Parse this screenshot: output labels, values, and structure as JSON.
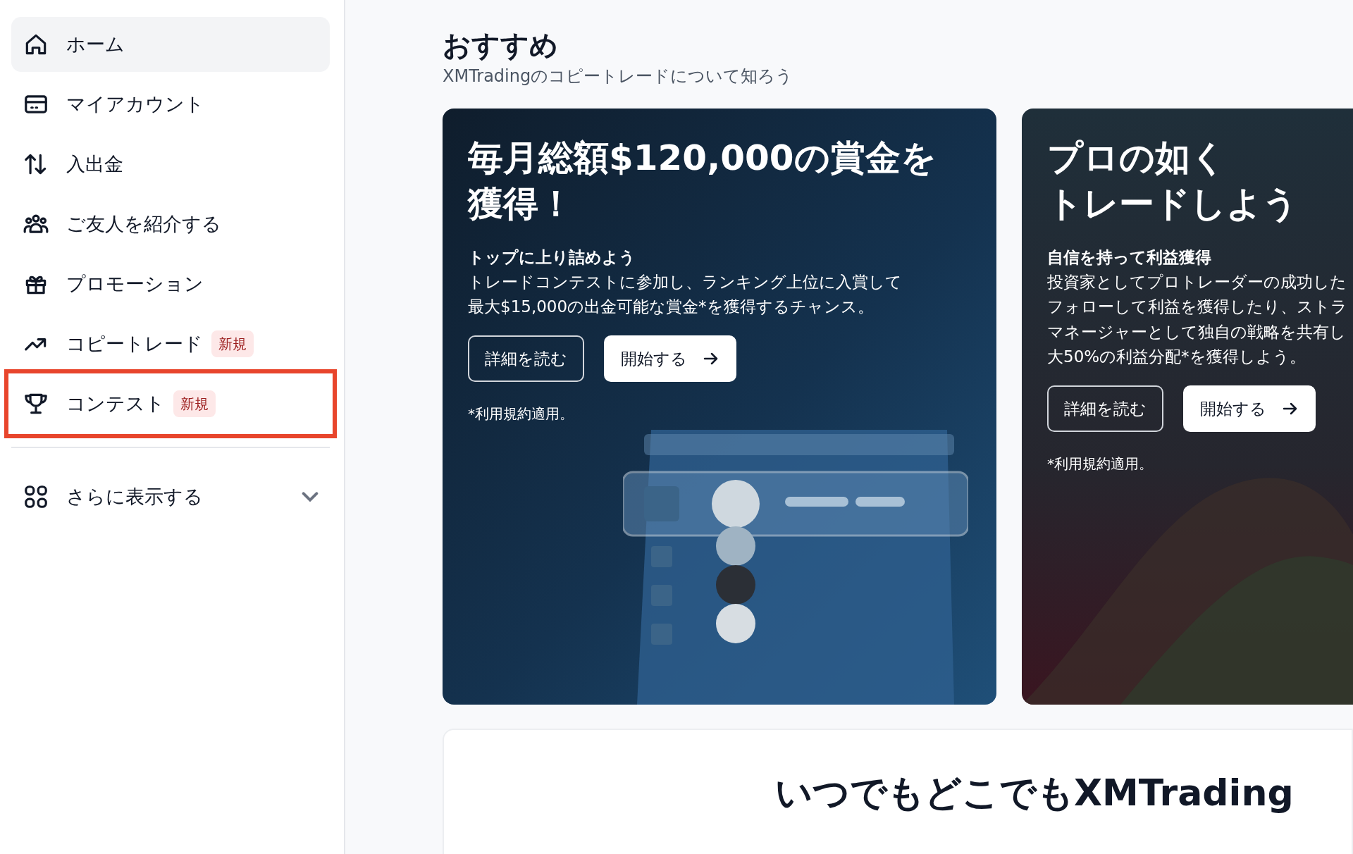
{
  "sidebar": {
    "items": [
      {
        "label": "ホーム",
        "selected": true,
        "highlighted": false
      },
      {
        "label": "マイアカウント",
        "selected": false,
        "highlighted": false
      },
      {
        "label": "入出金",
        "selected": false,
        "highlighted": false
      },
      {
        "label": "ご友人を紹介する",
        "selected": false,
        "highlighted": false
      },
      {
        "label": "プロモーション",
        "selected": false,
        "highlighted": false
      },
      {
        "label": "コピートレード",
        "badge": "新規",
        "selected": false,
        "highlighted": false
      },
      {
        "label": "コンテスト",
        "badge": "新規",
        "selected": false,
        "highlighted": true
      }
    ],
    "more": {
      "label": "さらに表示する",
      "expanded": false
    }
  },
  "main": {
    "heading": "おすすめ",
    "subtitle": "XMTradingのコピートレードについて知ろう",
    "cards": [
      {
        "kind": "blue",
        "title_lines": [
          "毎月総額$120,000の賞金を",
          "獲得！"
        ],
        "subheading": "トップに上り詰めよう",
        "body_lines": [
          "トレードコンテストに参加し、ランキング上位に入賞して",
          "最大$15,000の出金可能な賞金*を獲得するチャンス。"
        ],
        "buttons": [
          {
            "label": "詳細を読む",
            "kind": "outline"
          },
          {
            "label": "開始する",
            "kind": "solid"
          }
        ],
        "footnote": "*利用規約適用。"
      },
      {
        "kind": "dark",
        "title_lines": [
          "プロの如く",
          "トレードしよう"
        ],
        "subheading": "自信を持って利益獲得",
        "body_lines": [
          "投資家としてプロトレーダーの成功した",
          "フォローして利益を獲得したり、ストラ",
          "マネージャーとして独自の戦略を共有し",
          "大50%の利益分配*を獲得しよう。"
        ],
        "buttons": [
          {
            "label": "詳細を読む",
            "kind": "outline"
          },
          {
            "label": "開始する",
            "kind": "solid"
          }
        ],
        "footnote": "*利用規約適用。"
      }
    ],
    "app_card": {
      "title": "いつでもどこでもXMTrading"
    }
  }
}
